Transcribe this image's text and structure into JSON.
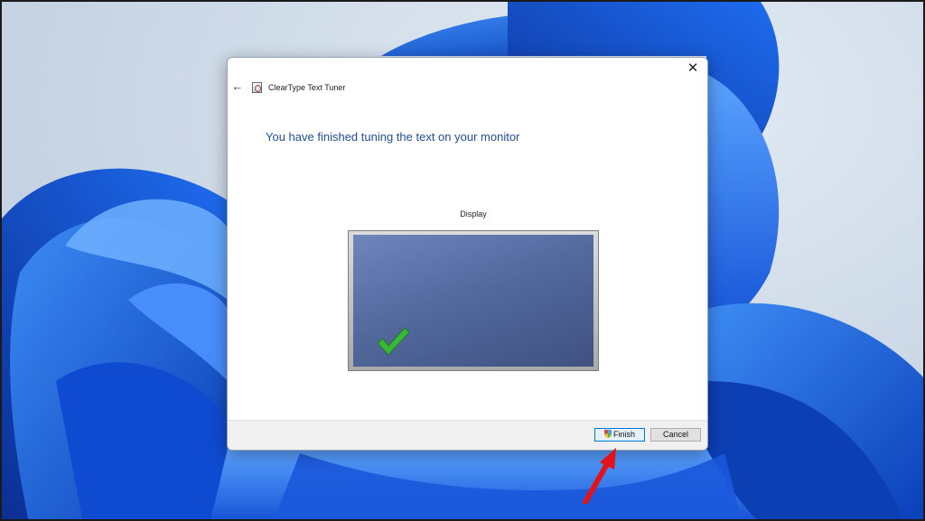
{
  "window": {
    "title": "ClearType Text Tuner",
    "close_glyph": "✕",
    "back_glyph": "←"
  },
  "content": {
    "heading": "You have finished tuning the text on your monitor",
    "display_label": "Display"
  },
  "buttons": {
    "finish_label": "Finish",
    "cancel_label": "Cancel"
  },
  "colors": {
    "heading": "#1f4e9c",
    "check": "#3bb53b",
    "arrow": "#e1141b",
    "wallpaper_blue": "#1763e6"
  },
  "icons": [
    "back-arrow-icon",
    "app-icon",
    "close-icon",
    "checkmark-icon",
    "shield-icon",
    "annotation-arrow"
  ]
}
